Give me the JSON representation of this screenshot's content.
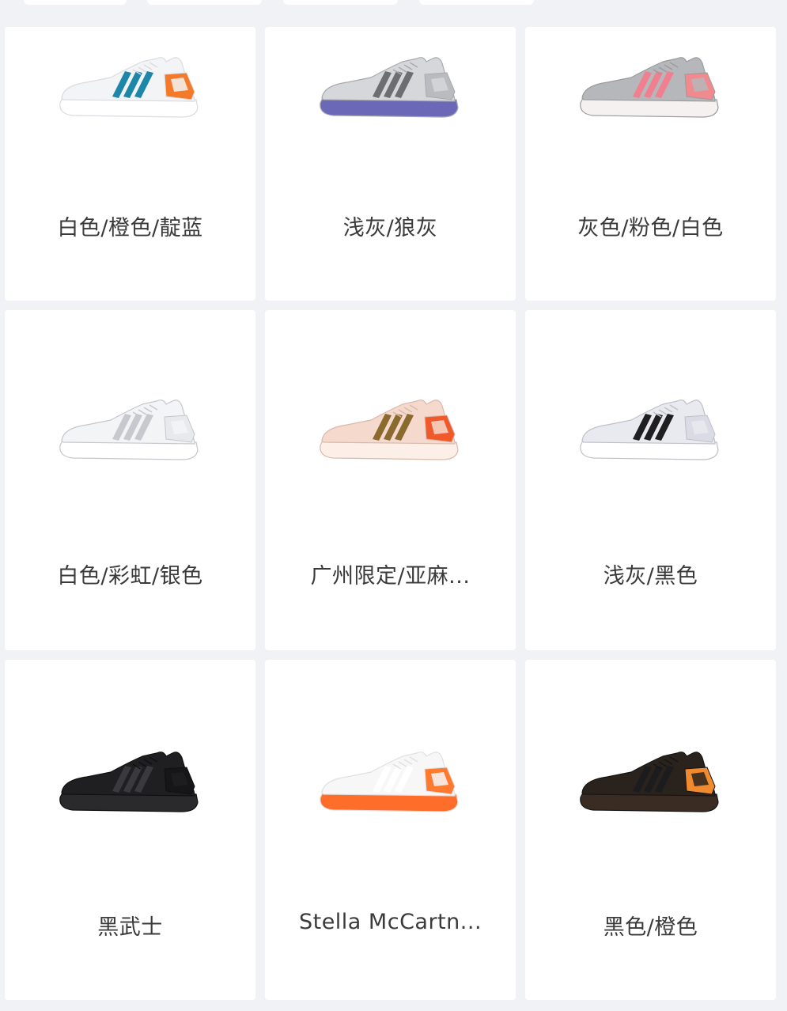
{
  "products": [
    {
      "label": "白色/橙色/靛蓝",
      "icon": "sneaker-icon",
      "upper": "#f3f4f6",
      "sole": "#ffffff",
      "stripe": "#1e86a8",
      "accent": "#f47a2a",
      "outline": "#d9dbe0"
    },
    {
      "label": "浅灰/狼灰",
      "icon": "sneaker-icon",
      "upper": "#d6d7da",
      "sole": "#6b68b8",
      "stripe": "#6c6e72",
      "accent": "#b9bbc0",
      "outline": "#a7a9ad"
    },
    {
      "label": "灰色/粉色/白色",
      "icon": "sneaker-icon",
      "upper": "#b6b7ba",
      "sole": "#f5f1f1",
      "stripe": "#f0808f",
      "accent": "#f08a8e",
      "outline": "#9a9b9e"
    },
    {
      "label": "白色/彩虹/银色",
      "icon": "sneaker-icon",
      "upper": "#f3f4f6",
      "sole": "#ffffff",
      "stripe": "#c7c9ce",
      "accent": "#e8e9ed",
      "outline": "#c5c7cc"
    },
    {
      "label": "广州限定/亚麻...",
      "icon": "sneaker-icon",
      "upper": "#f6d9cd",
      "sole": "#fbefe8",
      "stripe": "#8a6a2e",
      "accent": "#f05a2a",
      "outline": "#d8b9aa"
    },
    {
      "label": "浅灰/黑色",
      "icon": "sneaker-icon",
      "upper": "#e9e9f0",
      "sole": "#ffffff",
      "stripe": "#1f1f22",
      "accent": "#dadbe4",
      "outline": "#bfc0c8"
    },
    {
      "label": "黑武士",
      "icon": "sneaker-icon",
      "upper": "#1f1f22",
      "sole": "#2a2a2d",
      "stripe": "#3a3a3e",
      "accent": "#161618",
      "outline": "#101012"
    },
    {
      "label": "Stella McCartn...",
      "icon": "sneaker-icon",
      "upper": "#f7f7f8",
      "sole": "#ff6d2b",
      "stripe": "#ffffff",
      "accent": "#ff7a2f",
      "outline": "#e0e0e2"
    },
    {
      "label": "黑色/橙色",
      "icon": "sneaker-icon",
      "upper": "#2a221c",
      "sole": "#3a2b23",
      "stripe": "#1c1c1f",
      "accent": "#f08a2e",
      "outline": "#151515"
    }
  ]
}
